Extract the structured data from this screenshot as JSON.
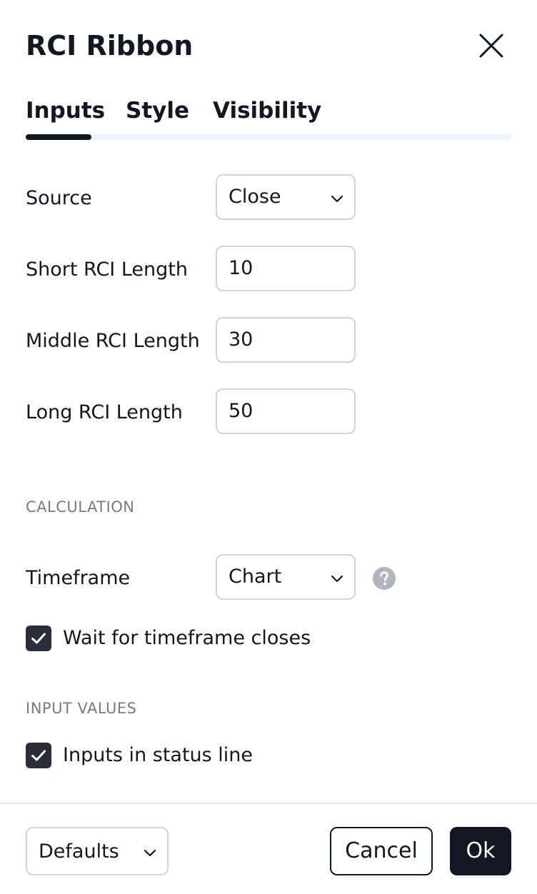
{
  "dialog": {
    "title": "RCI Ribbon"
  },
  "tabs": [
    {
      "label": "Inputs",
      "active": true
    },
    {
      "label": "Style",
      "active": false
    },
    {
      "label": "Visibility",
      "active": false
    }
  ],
  "inputs": {
    "source": {
      "label": "Source",
      "value": "Close"
    },
    "short_length": {
      "label": "Short RCI Length",
      "value": "10"
    },
    "middle_length": {
      "label": "Middle RCI Length",
      "value": "30"
    },
    "long_length": {
      "label": "Long RCI Length",
      "value": "50"
    }
  },
  "calculation": {
    "heading": "CALCULATION",
    "timeframe": {
      "label": "Timeframe",
      "value": "Chart"
    },
    "wait_for_close": {
      "label": "Wait for timeframe closes",
      "checked": true
    }
  },
  "input_values": {
    "heading": "INPUT VALUES",
    "inputs_in_status_line": {
      "label": "Inputs in status line",
      "checked": true
    }
  },
  "footer": {
    "defaults_label": "Defaults",
    "cancel_label": "Cancel",
    "ok_label": "Ok"
  },
  "icons": {
    "close": "close-icon",
    "chevron": "chevron-down-icon",
    "help": "question-mark-icon",
    "check": "checkmark-icon"
  },
  "colors": {
    "text": "#131722",
    "muted": "#787b86",
    "border": "#d1d4dc",
    "primary_button": "#131722",
    "checkbox": "#2a2e39"
  }
}
